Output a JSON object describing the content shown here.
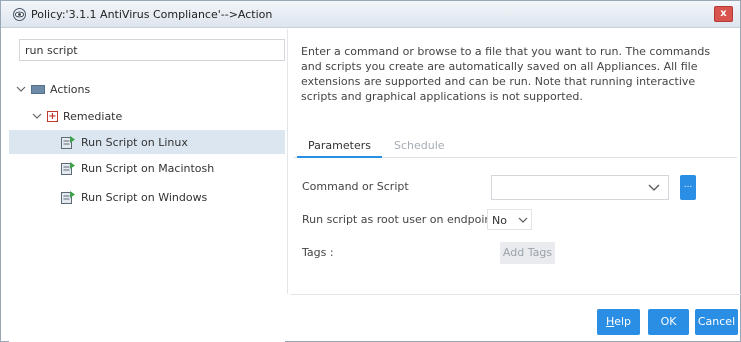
{
  "window": {
    "title": "Policy:'3.1.1 AntiVirus Compliance'-->Action",
    "close_label": "x",
    "close_color": "#d9534f",
    "accent_color": "#2b8ee5"
  },
  "search": {
    "value": "run script",
    "placeholder": ""
  },
  "tree": {
    "actions_label": "Actions",
    "remediate_label": "Remediate",
    "items": [
      {
        "label": "Run Script on Linux",
        "selected": true
      },
      {
        "label": "Run Script on Macintosh",
        "selected": false
      },
      {
        "label": "Run Script on Windows",
        "selected": false
      }
    ]
  },
  "description": "Enter a command or browse to a file that you want to run. The commands and scripts you create are automatically saved on all Appliances. All file extensions are supported and can be run. Note that running interactive scripts and graphical applications is not supported.",
  "tabs": [
    {
      "label": "Parameters",
      "active": true
    },
    {
      "label": "Schedule",
      "active": false
    }
  ],
  "form": {
    "command_label": "Command or Script",
    "command_value": "",
    "browse_label": "...",
    "root_label": "Run script as root user on endpoint",
    "root_value": "No",
    "tags_label": "Tags :",
    "add_tags_label": "Add Tags"
  },
  "buttons": {
    "help_first": "H",
    "help_rest": "elp",
    "ok": "OK",
    "cancel": "Cancel"
  }
}
